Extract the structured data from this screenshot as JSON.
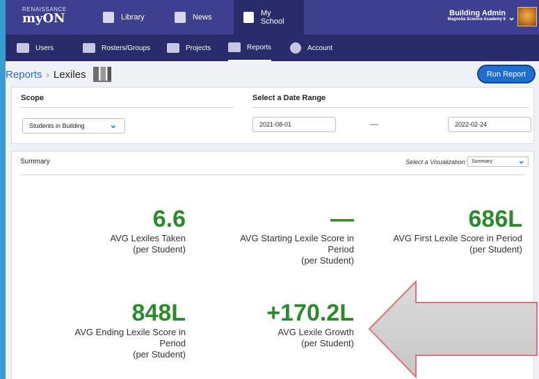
{
  "brand": {
    "small": "RENAISSANCE",
    "big": "myON"
  },
  "nav": {
    "tabs": [
      {
        "label": "Library",
        "icon": "library-icon"
      },
      {
        "label": "News",
        "icon": "news-icon"
      },
      {
        "label": "My School",
        "icon": "school-icon",
        "active": true
      }
    ]
  },
  "user": {
    "name": "Building Admin",
    "school": "Magnolia Science Academy 6"
  },
  "subnav": {
    "items": [
      {
        "label": "Users",
        "icon": "users-icon"
      },
      {
        "label": "Rosters/Groups",
        "icon": "rosters-icon"
      },
      {
        "label": "Projects",
        "icon": "projects-icon"
      },
      {
        "label": "Reports",
        "icon": "reports-icon",
        "active": true
      },
      {
        "label": "Account",
        "icon": "account-icon"
      }
    ]
  },
  "breadcrumb": {
    "root": "Reports",
    "separator": "›",
    "current": "Lexiles"
  },
  "run_report_label": "Run Report",
  "scope": {
    "title": "Scope",
    "value": "Students in Building"
  },
  "date_range": {
    "title": "Select a Date Range",
    "start": "2021-08-01",
    "separator": "—",
    "end": "2022-02-24"
  },
  "summary": {
    "title": "Summary",
    "viz_label": "Select a Visualization:",
    "viz_value": "Summary",
    "metrics": [
      {
        "value": "6.6",
        "label_lines": [
          "AVG Lexiles Taken",
          "(per Student)"
        ]
      },
      {
        "value": "—",
        "label_lines": [
          "AVG Starting Lexile Score in",
          "Period",
          "(per Student)"
        ]
      },
      {
        "value": "686L",
        "label_lines": [
          "AVG First Lexile Score in Period",
          "(per Student)"
        ]
      },
      {
        "value": "848L",
        "label_lines": [
          "AVG Ending Lexile Score in",
          "Period",
          "(per Student)"
        ]
      },
      {
        "value": "+170.2L",
        "label_lines": [
          "AVG Lexile Growth",
          "(per Student)"
        ]
      }
    ]
  },
  "colors": {
    "topbar": "#3d3f8f",
    "subnav": "#2a2c6a",
    "accent_blue": "#1f6fd0",
    "metric_green": "#2c8a2c",
    "outer_bg": "#3b9bd1"
  }
}
